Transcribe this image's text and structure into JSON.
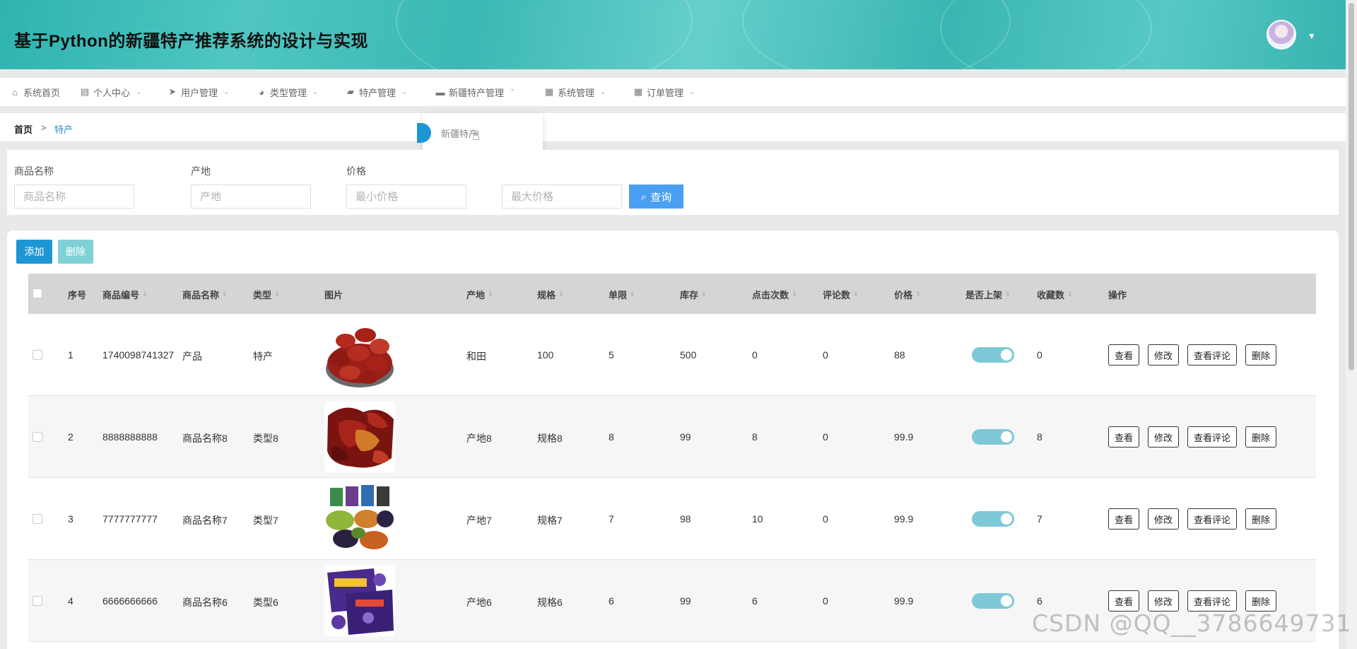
{
  "header": {
    "title": "基于Python的新疆特产推荐系统的设计与实现",
    "avatar_icon": "avatar-icon",
    "caret": "▼"
  },
  "nav": [
    {
      "label": "系统首页",
      "icon": "⌂",
      "chevron": ""
    },
    {
      "label": "个人中心",
      "icon": "▤",
      "chevron": "⌄"
    },
    {
      "label": "用户管理",
      "icon": "➤",
      "chevron": "⌄"
    },
    {
      "label": "类型管理",
      "icon": "◕",
      "chevron": "⌄"
    },
    {
      "label": "特产管理",
      "icon": "▰",
      "chevron": "⌄"
    },
    {
      "label": "新疆特产管理",
      "icon": "▬",
      "chevron": "⌃"
    },
    {
      "label": "系统管理",
      "icon": "▦",
      "chevron": "⌄"
    },
    {
      "label": "订单管理",
      "icon": "▦",
      "chevron": "⌄"
    }
  ],
  "dropdown": {
    "option": "新疆特产"
  },
  "breadcrumb": {
    "home": "首页",
    "separator": ">",
    "current": "特产"
  },
  "search": {
    "name_label": "商品名称",
    "name_placeholder": "商品名称",
    "origin_label": "产地",
    "origin_placeholder": "产地",
    "price_label": "价格",
    "min_placeholder": "最小价格",
    "max_placeholder": "最大价格",
    "query_label": "查询"
  },
  "toolbar": {
    "add_label": "添加",
    "delete_label": "删除"
  },
  "columns": [
    "序号",
    "商品编号",
    "商品名称",
    "类型",
    "图片",
    "产地",
    "规格",
    "单限",
    "库存",
    "点击次数",
    "评论数",
    "价格",
    "是否上架",
    "收藏数",
    "操作"
  ],
  "row_actions": [
    "查看",
    "修改",
    "查看评论",
    "删除"
  ],
  "rows": [
    {
      "index": "1",
      "code": "1740098741327",
      "name": "产品",
      "type": "特产",
      "origin": "和田",
      "spec": "100",
      "limit": "5",
      "stock": "500",
      "clicks": "0",
      "comments": "0",
      "price": "88",
      "on_shelf": true,
      "favorites": "0",
      "image": "red-dates"
    },
    {
      "index": "2",
      "code": "8888888888",
      "name": "商品名称8",
      "type": "类型8",
      "origin": "产地8",
      "spec": "规格8",
      "limit": "8",
      "stock": "99",
      "clicks": "8",
      "comments": "0",
      "price": "99.9",
      "on_shelf": true,
      "favorites": "8",
      "image": "dried-fruit"
    },
    {
      "index": "3",
      "code": "7777777777",
      "name": "商品名称7",
      "type": "类型7",
      "origin": "产地7",
      "spec": "规格7",
      "limit": "7",
      "stock": "98",
      "clicks": "10",
      "comments": "0",
      "price": "99.9",
      "on_shelf": true,
      "favorites": "7",
      "image": "raisins"
    },
    {
      "index": "4",
      "code": "6666666666",
      "name": "商品名称6",
      "type": "类型6",
      "origin": "产地6",
      "spec": "规格6",
      "limit": "6",
      "stock": "99",
      "clicks": "6",
      "comments": "0",
      "price": "99.9",
      "on_shelf": true,
      "favorites": "6",
      "image": "candy-bags"
    }
  ],
  "colors": {
    "accent": "#1e96d4",
    "query": "#4aa0f0",
    "toggle": "#7ec9d8",
    "header": "#3bb8b5"
  },
  "watermark": "CSDN @QQ__3786649731"
}
